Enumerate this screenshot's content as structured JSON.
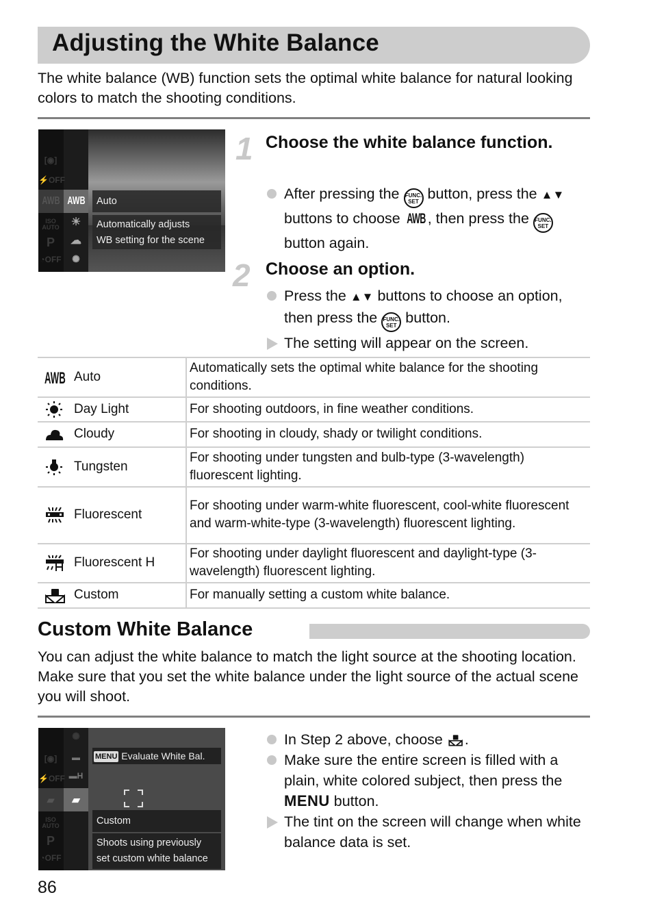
{
  "page": {
    "title": "Adjusting the White Balance",
    "intro": "The white balance (WB) function sets the optimal white balance for natural looking colors to match the shooting conditions.",
    "page_number": "86"
  },
  "camera_screen_1": {
    "left_icons": [
      "metering",
      "flash-off",
      "AWB",
      "ISO AUTO",
      "P",
      "self-timer-off"
    ],
    "option_icons": [
      "AWB",
      "daylight",
      "cloudy",
      "tungsten"
    ],
    "selected_label": "Auto",
    "description_line1": "Automatically adjusts",
    "description_line2": "WB setting for the scene"
  },
  "steps": [
    {
      "number": "1",
      "title": "Choose the white balance function.",
      "bullets": [
        {
          "type": "dot",
          "parts": [
            "After pressing the",
            "button, press the",
            "buttons to choose",
            ", then press the",
            "button again."
          ]
        }
      ]
    },
    {
      "number": "2",
      "title": "Choose an option.",
      "bullets": [
        {
          "type": "dot",
          "parts": [
            "Press the",
            "buttons to choose an option, then press the",
            "button."
          ]
        },
        {
          "type": "arrow",
          "text": "The setting will appear on the screen."
        }
      ]
    }
  ],
  "icons": {
    "func_set_top": "FUNC.",
    "func_set_bottom": "SET",
    "awb": "AWB",
    "up_down": "▲▼",
    "menu": "MENU"
  },
  "wb_table": [
    {
      "icon": "awb-icon",
      "name": "Auto",
      "description": "Automatically sets the optimal white balance for the shooting conditions."
    },
    {
      "icon": "daylight-icon",
      "name": "Day Light",
      "description": "For shooting outdoors, in fine weather conditions."
    },
    {
      "icon": "cloudy-icon",
      "name": "Cloudy",
      "description": "For shooting in cloudy, shady or twilight conditions."
    },
    {
      "icon": "tungsten-icon",
      "name": "Tungsten",
      "description": "For shooting under tungsten and bulb-type (3-wavelength) fluorescent lighting."
    },
    {
      "icon": "fluorescent-icon",
      "name": "Fluorescent",
      "description": "For shooting under warm-white fluorescent, cool-white fluorescent and warm-white-type (3-wavelength) fluorescent lighting."
    },
    {
      "icon": "fluorescent-h-icon",
      "name": "Fluorescent H",
      "description": "For shooting under daylight fluorescent and daylight-type (3-wavelength) fluorescent lighting."
    },
    {
      "icon": "custom-wb-icon",
      "name": "Custom",
      "description": "For manually setting a custom white balance."
    }
  ],
  "custom_section": {
    "heading": "Custom White Balance",
    "intro": "You can adjust the white balance to match the light source at the shooting location. Make sure that you set the white balance under the light source of the actual scene you will shoot.",
    "bullets": [
      {
        "type": "dot",
        "parts": [
          "In Step 2 above, choose",
          "."
        ]
      },
      {
        "type": "dot",
        "parts": [
          "Make sure the entire screen is filled with a plain, white colored subject, then press the",
          "button."
        ]
      },
      {
        "type": "arrow",
        "text": "The tint on the screen will change when white balance data is set."
      }
    ]
  },
  "camera_screen_2": {
    "menu_badge": "MENU",
    "menu_label": "Evaluate White Bal.",
    "selected_label": "Custom",
    "description_line1": "Shoots using previously",
    "description_line2": "set custom white balance"
  }
}
